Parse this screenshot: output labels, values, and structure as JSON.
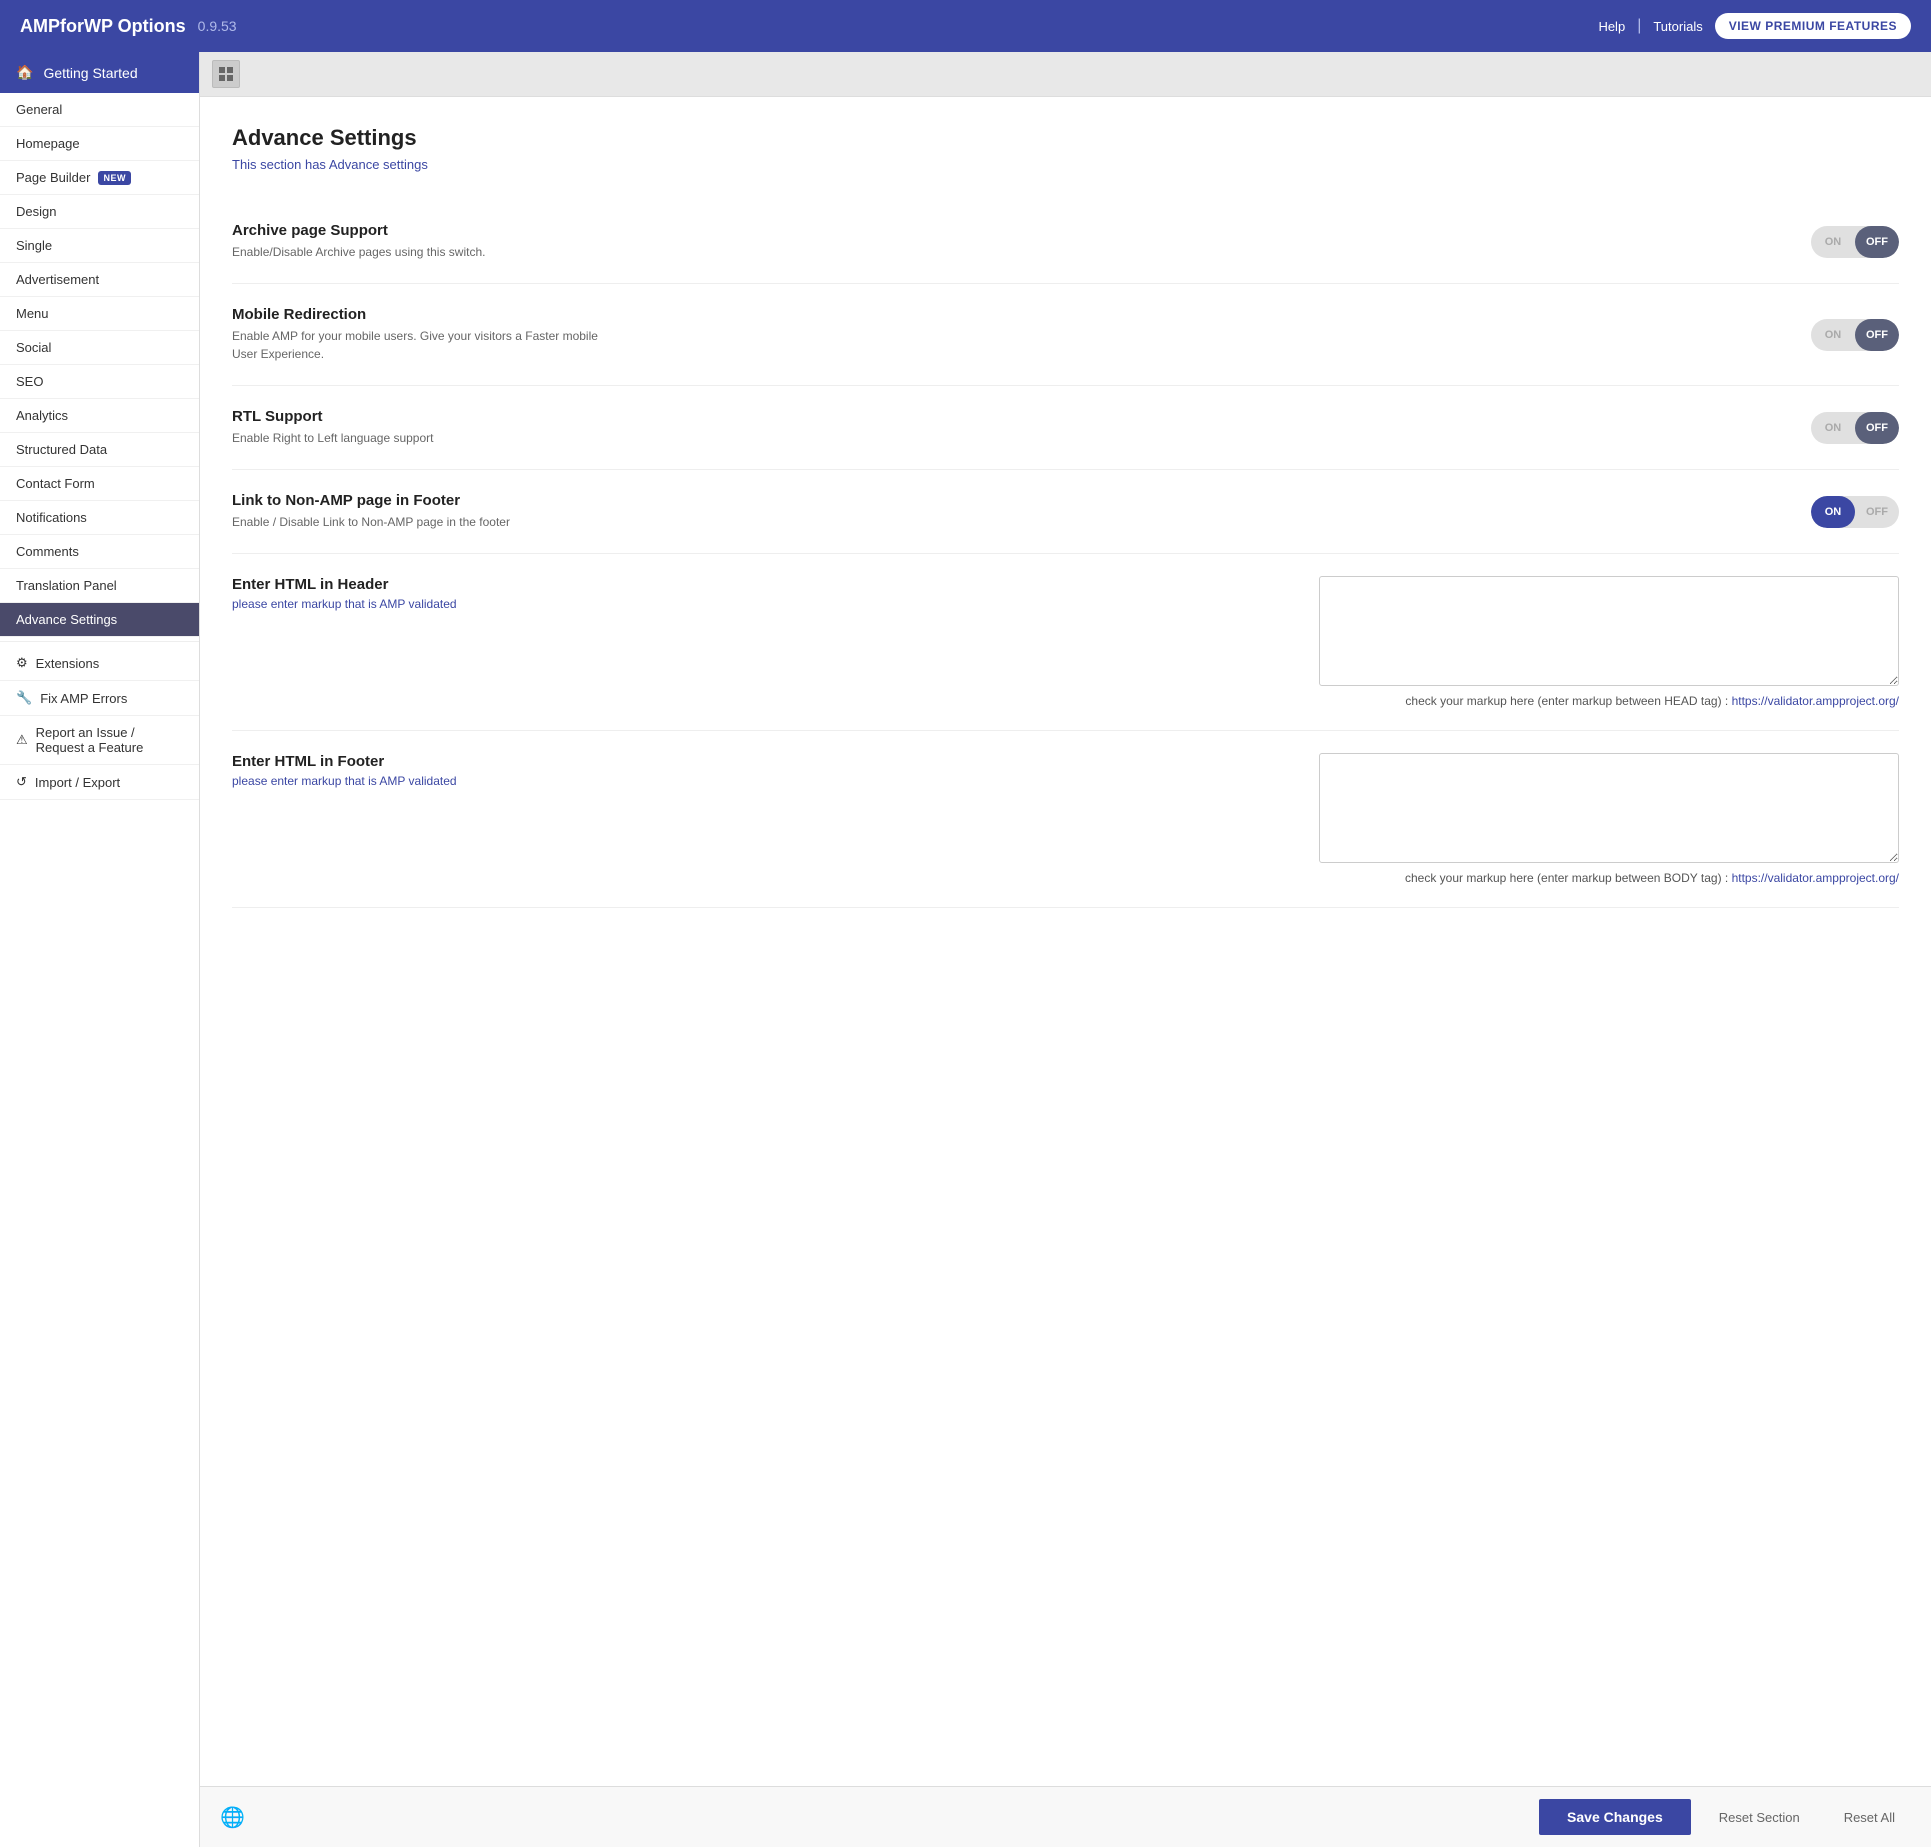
{
  "header": {
    "title": "AMPforWP Options",
    "version": "0.9.53",
    "help_label": "Help",
    "tutorials_label": "Tutorials",
    "premium_btn": "VIEW PREMIUM FEATURES"
  },
  "sidebar": {
    "getting_started": "Getting Started",
    "items": [
      {
        "label": "General",
        "active": false,
        "id": "general"
      },
      {
        "label": "Homepage",
        "active": false,
        "id": "homepage"
      },
      {
        "label": "Page Builder",
        "active": false,
        "id": "page-builder",
        "badge": "NEW"
      },
      {
        "label": "Design",
        "active": false,
        "id": "design"
      },
      {
        "label": "Single",
        "active": false,
        "id": "single"
      },
      {
        "label": "Advertisement",
        "active": false,
        "id": "advertisement"
      },
      {
        "label": "Menu",
        "active": false,
        "id": "menu"
      },
      {
        "label": "Social",
        "active": false,
        "id": "social"
      },
      {
        "label": "SEO",
        "active": false,
        "id": "seo"
      },
      {
        "label": "Analytics",
        "active": false,
        "id": "analytics"
      },
      {
        "label": "Structured Data",
        "active": false,
        "id": "structured-data"
      },
      {
        "label": "Contact Form",
        "active": false,
        "id": "contact-form"
      },
      {
        "label": "Notifications",
        "active": false,
        "id": "notifications"
      },
      {
        "label": "Comments",
        "active": false,
        "id": "comments"
      },
      {
        "label": "Translation Panel",
        "active": false,
        "id": "translation-panel"
      },
      {
        "label": "Advance Settings",
        "active": true,
        "id": "advance-settings"
      }
    ],
    "extensions_label": "Extensions",
    "fix_amp_label": "Fix AMP Errors",
    "report_label": "Report an Issue / Request a Feature",
    "import_export_label": "Import / Export"
  },
  "content": {
    "page_title": "Advance Settings",
    "page_subtitle": "This section has Advance settings",
    "settings": [
      {
        "id": "archive-page-support",
        "title": "Archive page Support",
        "desc": "Enable/Disable Archive pages using this switch.",
        "toggle_state": "off"
      },
      {
        "id": "mobile-redirection",
        "title": "Mobile Redirection",
        "desc": "Enable AMP for your mobile users. Give your visitors a Faster mobile User Experience.",
        "toggle_state": "off"
      },
      {
        "id": "rtl-support",
        "title": "RTL Support",
        "desc": "Enable Right to Left language support",
        "toggle_state": "off"
      },
      {
        "id": "link-non-amp-footer",
        "title": "Link to Non-AMP page in Footer",
        "desc": "Enable / Disable Link to Non-AMP page in the footer",
        "toggle_state": "on"
      }
    ],
    "html_header": {
      "title": "Enter HTML in Header",
      "placeholder": "please enter markup that is AMP validated",
      "check_text": "check your markup here (enter markup between HEAD tag) : ",
      "check_link": "https://validator.ampproject.org/"
    },
    "html_footer": {
      "title": "Enter HTML in Footer",
      "placeholder": "please enter markup that is AMP validated",
      "check_text": "check your markup here (enter markup between BODY tag) : ",
      "check_link": "https://validator.ampproject.org/"
    }
  },
  "footer": {
    "save_label": "Save Changes",
    "reset_section_label": "Reset Section",
    "reset_all_label": "Reset All"
  },
  "labels": {
    "on": "ON",
    "off": "OFF"
  }
}
